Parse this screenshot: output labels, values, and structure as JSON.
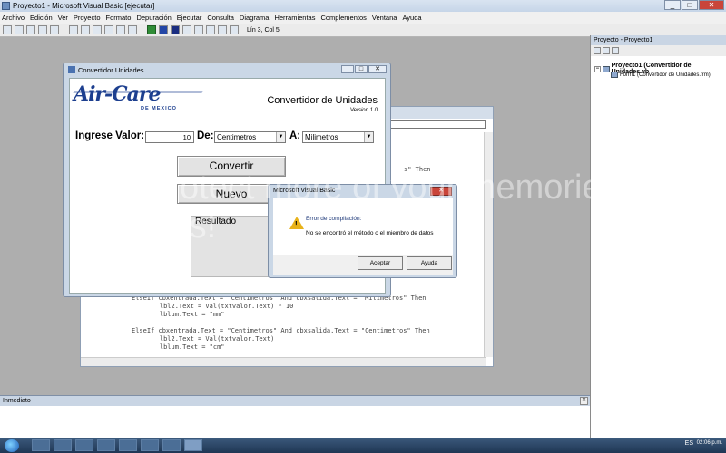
{
  "window": {
    "title": "Proyecto1 - Microsoft Visual Basic [ejecutar]",
    "btn_min": "_",
    "btn_max": "□",
    "btn_close": "✕"
  },
  "menu": [
    "Archivo",
    "Edición",
    "Ver",
    "Proyecto",
    "Formato",
    "Depuración",
    "Ejecutar",
    "Consulta",
    "Diagrama",
    "Herramientas",
    "Complementos",
    "Ventana",
    "Ayuda"
  ],
  "toolbar": {
    "position": "Lín 3, Col 5"
  },
  "code": {
    "line_top": "s\" Then",
    "lines": [
      "ElseIf cbxentrada.Text = \"Centimetros\" And cbxsalida.Text = \"Milimetros\" Then",
      "    lbl2.Text = Val(txtvalor.Text) * 10",
      "    lblum.Text = \"mm\"",
      "",
      "ElseIf cbxentrada.Text = \"Centimetros\" And cbxsalida.Text = \"Centimetros\" Then",
      "    lbl2.Text = Val(txtvalor.Text)",
      "    lblum.Text = \"cm\""
    ]
  },
  "form": {
    "title": "Convertidor Unidades",
    "logo_brand": "Air-Care",
    "logo_sub": "DE MEXICO",
    "heading": "Convertidor de Unidades",
    "version": "Version 1.0",
    "ingrese_label": "Ingrese Valor:",
    "input_value": "10",
    "de_label": "De:",
    "de_selected": "Centimetros",
    "a_label": "A:",
    "a_selected": "Milimetros",
    "convert_label": "Convertir",
    "nuevo_label": "Nuevo",
    "resultado_label": "Resultado"
  },
  "msgbox": {
    "title": "Microsoft Visual Basic",
    "heading": "Error de compilación:",
    "message": "No se encontró el método o el miembro de datos",
    "ok": "Aceptar",
    "help": "Ayuda"
  },
  "immediate": {
    "title": "Inmediato"
  },
  "project": {
    "title": "Proyecto - Proyecto1",
    "root": "Proyecto1 (Convertidor de Unidades.vb",
    "child": "Form1 (Convertidor de Unidades.frm)"
  },
  "taskbar": {
    "lang": "ES",
    "time": "02:06 p.m."
  },
  "watermark": {
    "text": "Protect more of your memories for less!"
  },
  "colors": {
    "brand_blue": "#1d3f8f",
    "taskbar": "#1f3654",
    "close_red": "#c9453a"
  }
}
